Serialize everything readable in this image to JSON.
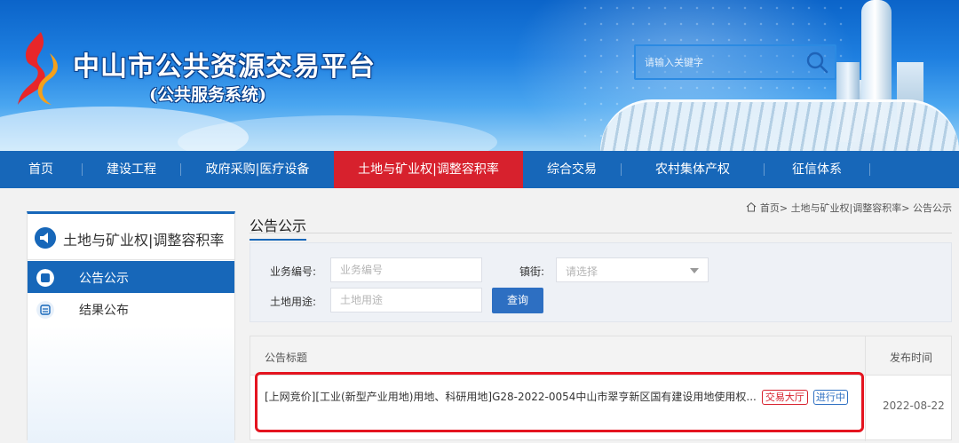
{
  "header": {
    "site_title": "中山市公共资源交易平台",
    "site_subtitle": "(公共服务系统)",
    "search_placeholder": "请输入关键字"
  },
  "nav": {
    "items": [
      {
        "label": "首页"
      },
      {
        "label": "建设工程"
      },
      {
        "label": "政府采购|医疗设备"
      },
      {
        "label": "土地与矿业权|调整容积率",
        "active": true
      },
      {
        "label": "综合交易"
      },
      {
        "label": "农村集体产权"
      },
      {
        "label": "征信体系"
      }
    ]
  },
  "sidebar": {
    "title": "土地与矿业权|调整容积率",
    "items": [
      {
        "label": "公告公示",
        "active": true
      },
      {
        "label": "结果公布"
      }
    ]
  },
  "breadcrumb": {
    "home": "首页",
    "sep1": ">",
    "section": "土地与矿业权|调整容积率",
    "sep2": ">",
    "current": "公告公示"
  },
  "main": {
    "title": "公告公示",
    "filters": {
      "business_no_label": "业务编号:",
      "business_no_placeholder": "业务编号",
      "town_label": "镇街:",
      "town_placeholder": "请选择",
      "land_use_label": "土地用途:",
      "land_use_placeholder": "土地用途",
      "query_label": "查询"
    },
    "table": {
      "col_title": "公告标题",
      "col_date": "发布时间",
      "rows": [
        {
          "title": "[上网竞价][工业(新型产业用地)用地、科研用地]G28-2022-0054中山市翠亨新区国有建设用地使用权...",
          "hall_tag": "交易大厅",
          "status_tag": "进行中",
          "date": "2022-08-22"
        }
      ]
    }
  },
  "colors": {
    "nav_bg": "#1767b9",
    "nav_active": "#d7212d",
    "highlight": "#e4141f"
  }
}
